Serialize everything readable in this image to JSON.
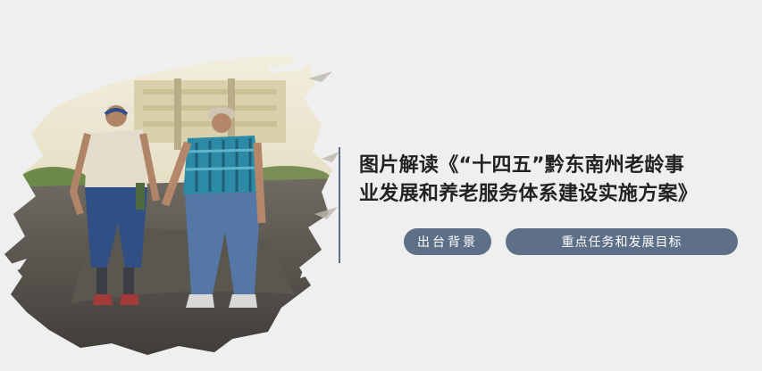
{
  "title": {
    "line1": "图片解读《“十四五”黔东南州老龄事",
    "line2": "业发展和养老服务体系建设实施方案》"
  },
  "buttons": [
    {
      "label": "出台背景"
    },
    {
      "label": "重点任务和发展目标"
    }
  ],
  "colors": {
    "background": "#efefef",
    "accent": "#5d7088",
    "divider": "#5b6f86",
    "title_text": "#222222"
  },
  "image": {
    "subject": "elderly-couple-walking-hand-in-hand-photo"
  }
}
